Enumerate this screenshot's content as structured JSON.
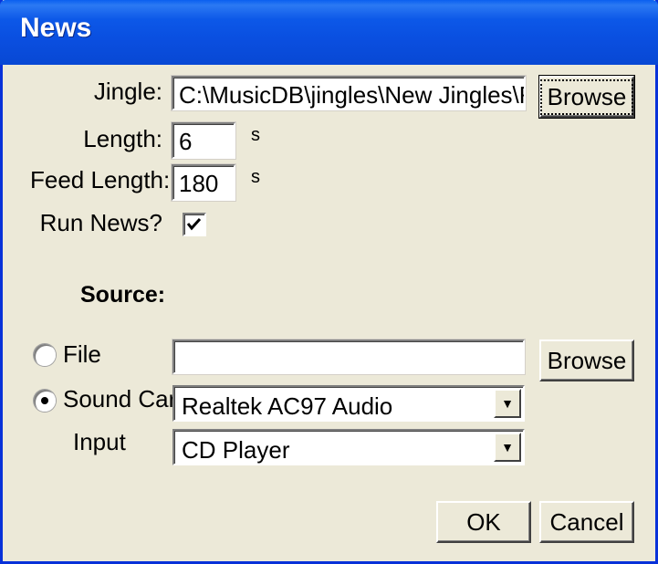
{
  "window": {
    "title": "News"
  },
  "jingle": {
    "label": "Jingle:",
    "value": "C:\\MusicDB\\jingles\\New Jingles\\RWF",
    "browse_label": "Browse"
  },
  "length": {
    "label": "Length:",
    "value": "6",
    "unit": "s"
  },
  "feed_length": {
    "label": "Feed Length:",
    "value": "180",
    "unit": "s"
  },
  "run_news": {
    "label": "Run News?",
    "checked": true
  },
  "source": {
    "heading": "Source:",
    "file_label": "File",
    "file_value": "",
    "file_browse_label": "Browse",
    "sound_card_label": "Sound Card",
    "sound_card_value": "Realtek AC97 Audio",
    "input_label": "Input",
    "input_value": "CD Player",
    "selected": "sound_card"
  },
  "buttons": {
    "ok": "OK",
    "cancel": "Cancel"
  },
  "icons": {
    "check": "checkmark-icon",
    "dropdown": "dropdown-arrow-icon"
  }
}
